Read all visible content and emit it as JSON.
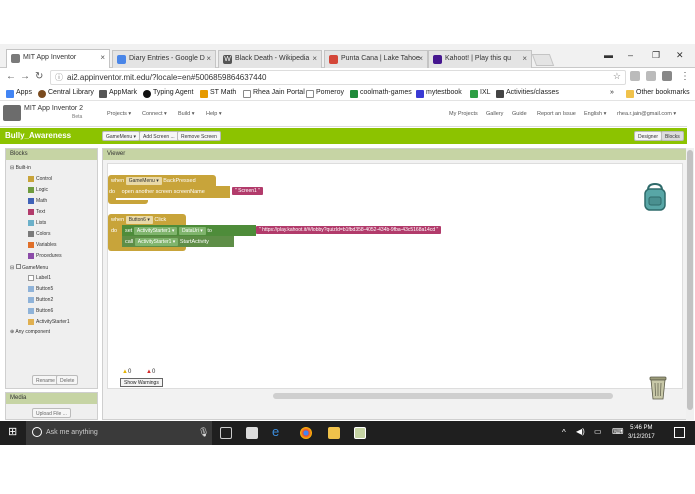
{
  "browser": {
    "tabs": [
      {
        "title": "MIT App Inventor",
        "icon": "app-inventor-favicon",
        "color": "#7a7a7a",
        "active": true
      },
      {
        "title": "Diary Entries - Google D",
        "icon": "google-docs-favicon",
        "color": "#4a86e8",
        "active": false
      },
      {
        "title": "Black Death - Wikipedia",
        "icon": "wikipedia-favicon",
        "color": "#555555",
        "active": false
      },
      {
        "title": "Punta Cana | Lake Tahoe",
        "icon": "gmail-favicon",
        "color": "#d44638",
        "active": false
      },
      {
        "title": "Kahoot! | Play this qu",
        "icon": "kahoot-favicon",
        "color": "#46178f",
        "active": false
      }
    ],
    "url": "ai2.appinventor.mit.edu/?locale=en#5006859864637440",
    "bookmarks": [
      {
        "label": "Apps",
        "color": "#4285f4"
      },
      {
        "label": "Central Library",
        "color": "#7a4b1f"
      },
      {
        "label": "AppMark",
        "color": "#555555"
      },
      {
        "label": "Typing Agent",
        "color": "#111111"
      },
      {
        "label": "ST Math",
        "color": "#e69a00"
      },
      {
        "label": "Rhea Jain Portal",
        "color": "#888888"
      },
      {
        "label": "Pomeroy",
        "color": "#888888"
      },
      {
        "label": "coolmath-games",
        "color": "#1f8a3a"
      },
      {
        "label": "mytestbook",
        "color": "#3a3ad4"
      },
      {
        "label": "IXL",
        "color": "#2e9f44"
      },
      {
        "label": "Activities/classes",
        "color": "#444444"
      }
    ],
    "overflow": "»",
    "other_bookmarks": "Other bookmarks"
  },
  "app": {
    "logo_title": "MIT App Inventor 2",
    "logo_sub": "Beta",
    "menu": [
      "Projects ▾",
      "Connect ▾",
      "Build ▾",
      "Help ▾"
    ],
    "right_links": [
      "My Projects",
      "Gallery",
      "Guide",
      "Report an Issue",
      "English ▾",
      "rhea.r.jain@gmail.com ▾"
    ],
    "project_name": "Bully_Awareness",
    "project_buttons": [
      "GameMenu ▾",
      "Add Screen ...",
      "Remove Screen"
    ],
    "mode_buttons": [
      "Designer",
      "Blocks"
    ]
  },
  "blocks_panel": {
    "title": "Blocks",
    "builtin": "Built-in",
    "builtins": [
      {
        "label": "Control",
        "color": "#c8a43a"
      },
      {
        "label": "Logic",
        "color": "#6f9c3f"
      },
      {
        "label": "Math",
        "color": "#3f62b8"
      },
      {
        "label": "Text",
        "color": "#b23b6b"
      },
      {
        "label": "Lists",
        "color": "#6bb0c9"
      },
      {
        "label": "Colors",
        "color": "#7a7a7a"
      },
      {
        "label": "Variables",
        "color": "#e0702a"
      },
      {
        "label": "Procedures",
        "color": "#8b4ba8"
      }
    ],
    "screen": "GameMenu",
    "components": [
      "Label1",
      "Button5",
      "Button2",
      "Button6",
      "ActivityStarter1"
    ],
    "any_component": "Any component",
    "rename": "Rename",
    "delete": "Delete"
  },
  "media_panel": {
    "title": "Media",
    "upload": "Upload File ..."
  },
  "viewer": {
    "title": "Viewer",
    "block1": {
      "when": "when",
      "component": "GameMenu ▾",
      "event": "BackPressed",
      "do": "do",
      "action": "open another screen  screenName",
      "value": "\" Screen1 \""
    },
    "block2": {
      "when": "when",
      "component": "Button6 ▾",
      "event": "Click",
      "do": "do",
      "set": "set",
      "setter_comp": "ActivityStarter1 ▾",
      "property": "DataUri ▾",
      "to": "to",
      "url": "\" https://play.kahoot.it/#/lobby?quizId=b1fbd358-4052-434b-9fba-43c5168a14cd \"",
      "call": "call",
      "call_comp": "ActivityStarter1 ▾",
      "method": "StartActivity"
    },
    "warnings_count": "0",
    "errors_count": "0",
    "show_warnings": "Show Warnings"
  },
  "taskbar": {
    "search_placeholder": "Ask me anything",
    "time": "5:46 PM",
    "date": "3/12/2017"
  }
}
